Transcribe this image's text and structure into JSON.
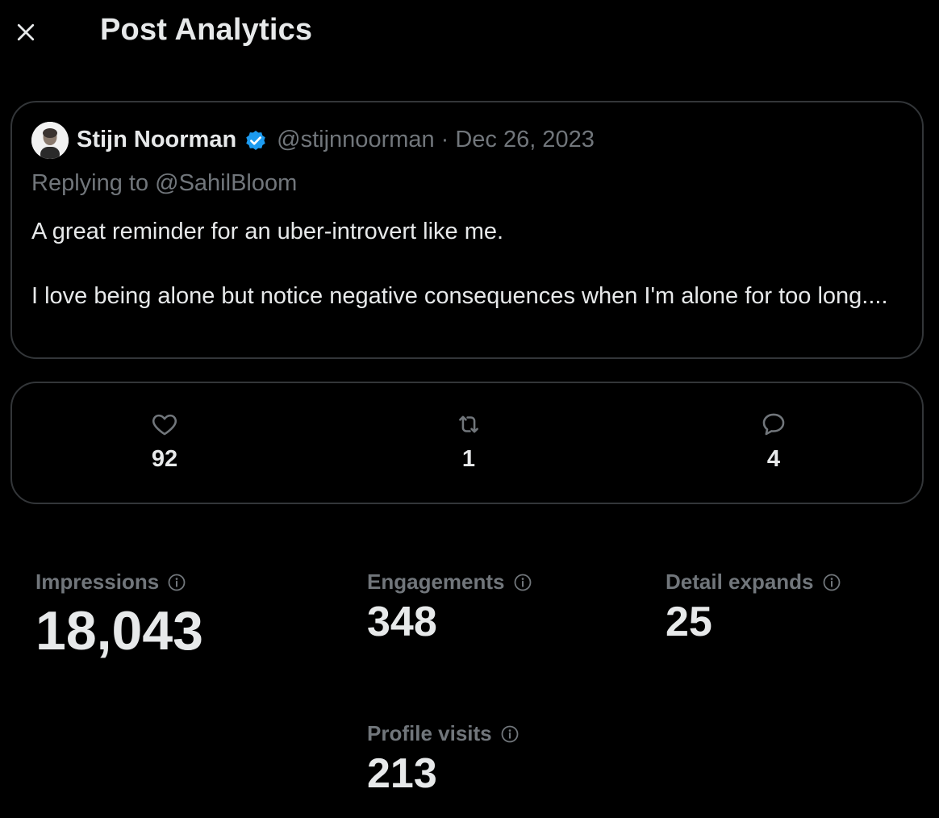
{
  "header": {
    "title": "Post Analytics",
    "close_icon": "close-icon"
  },
  "tweet": {
    "author_name": "Stijn Noorman",
    "verified_icon": "verified-badge-icon",
    "handle": "@stijnnoorman",
    "separator": "·",
    "date": "Dec 26, 2023",
    "replying_to": "Replying to @SahilBloom",
    "text_line1": "A great reminder for an uber-introvert like me.",
    "text_line2": "I love being alone but notice negative consequences when I'm alone for too long...."
  },
  "metrics": {
    "likes": {
      "icon": "heart-icon",
      "count": "92"
    },
    "reposts": {
      "icon": "repost-icon",
      "count": "1"
    },
    "replies": {
      "icon": "reply-icon",
      "count": "4"
    }
  },
  "stats": {
    "impressions": {
      "label": "Impressions",
      "value": "18,043"
    },
    "engagements": {
      "label": "Engagements",
      "value": "348"
    },
    "detail_expands": {
      "label": "Detail expands",
      "value": "25"
    },
    "profile_visits": {
      "label": "Profile visits",
      "value": "213"
    }
  },
  "colors": {
    "background": "#000000",
    "text_primary": "#e7e9ea",
    "text_secondary": "#71767b",
    "border": "#333639",
    "verified_blue": "#1d9bf0"
  }
}
